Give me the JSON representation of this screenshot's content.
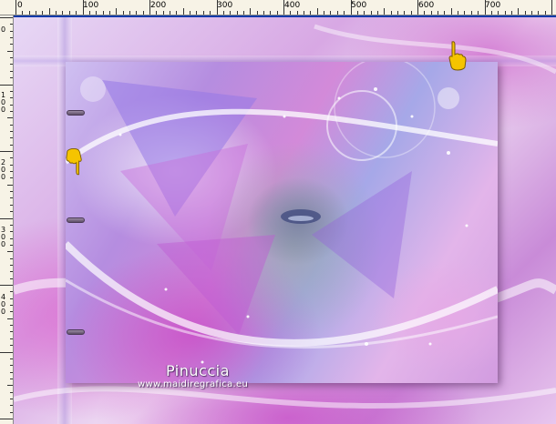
{
  "ruler_top": {
    "labels": [
      "0",
      "100",
      "200",
      "300",
      "400",
      "500",
      "600",
      "700"
    ]
  },
  "ruler_left": {
    "labels": [
      "0",
      "100",
      "200",
      "300",
      "400"
    ]
  },
  "signature": {
    "name": "Pinuccia",
    "site": "www.maidiregrafica.eu"
  },
  "colors": {
    "guide_line": "#0a3aa8",
    "ruler_bg": "#f7f3e6",
    "pointer_hand": "#f5c400"
  },
  "icons": {
    "pointer_top": "pointing-hand-icon",
    "pointer_left": "pointing-hand-icon"
  }
}
